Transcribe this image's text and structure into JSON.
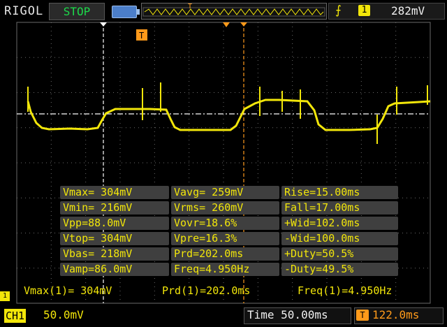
{
  "brand": "RIGOL",
  "run_state": "STOP",
  "trigger": {
    "slope_icon": "rising-edge-icon",
    "channel": "1",
    "level": "282mV"
  },
  "colors": {
    "trace": "#f2e60a",
    "grid": "#6a6a6a",
    "trigger_marker": "#ff9a1a",
    "run_state": "#1cd94a"
  },
  "trig_marker": "T",
  "measurements": {
    "col1": [
      "Vmax= 304mV",
      "Vmin= 216mV",
      "Vpp=88.0mV",
      "Vtop= 304mV",
      "Vbas= 218mV",
      "Vamp=86.0mV"
    ],
    "col2": [
      "Vavg= 259mV",
      "Vrms= 260mV",
      "Vovr=18.6%",
      "Vpre=16.3%",
      "Prd=202.0ms",
      "Freq=4.950Hz"
    ],
    "col3": [
      "Rise=15.00ms",
      "Fall=17.00ms",
      "+Wid=102.0ms",
      "-Wid=100.0ms",
      "+Duty=50.5%",
      "-Duty=49.5%"
    ]
  },
  "summary": {
    "vmax": "Vmax(1)= 304mV",
    "prd": "Prd(1)=202.0ms",
    "freq": "Freq(1)=4.950Hz"
  },
  "channel": {
    "label": "CH1",
    "scale": "50.0mV"
  },
  "timebase": {
    "text": "Time 50.00ms"
  },
  "trigger_offset": {
    "icon": "T",
    "text": "122.0ms"
  },
  "marker": "1"
}
